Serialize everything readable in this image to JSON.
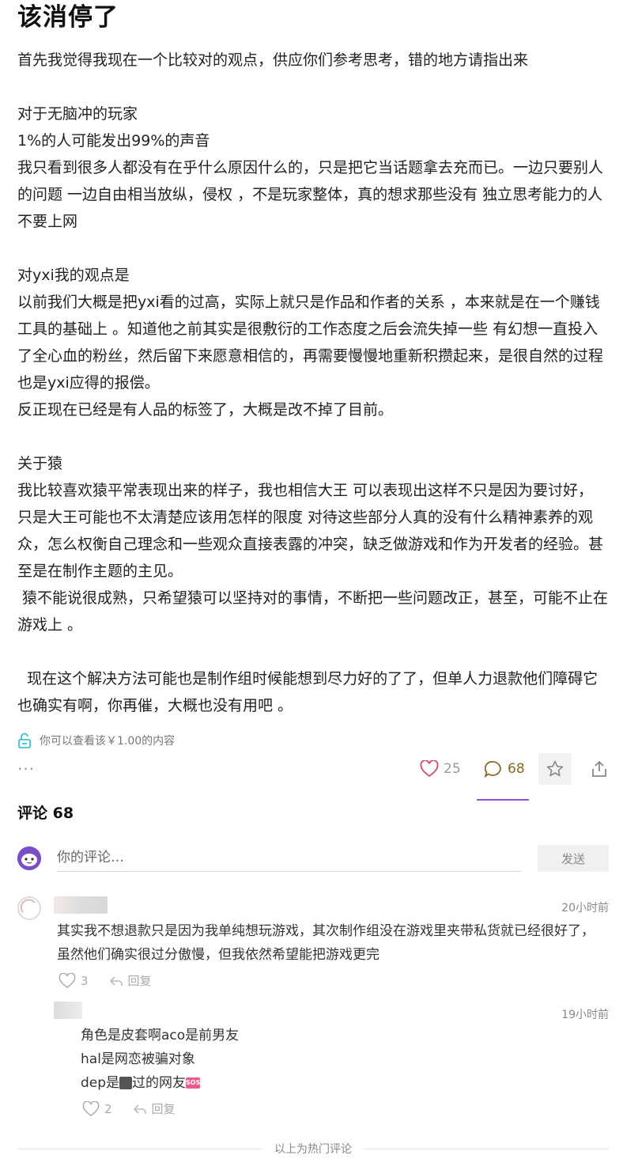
{
  "post": {
    "title": "该消停了",
    "paragraphs": [
      "首先我觉得我现在一个比较对的观点，供应你们参考思考，错的地方请指出来",
      "",
      "对于无脑冲的玩家",
      "1%的人可能发出99%的声音",
      "我只看到很多人都没有在乎什么原因什么的，只是把它当话题拿去充而已。一边只要别人的问题 一边自由相当放纵，侵权 ，不是玩家整体，真的想求那些没有 独立思考能力的人不要上网",
      "",
      "对yxi我的观点是",
      "以前我们大概是把yxi看的过高，实际上就只是作品和作者的关系 ，本来就是在一个赚钱工具的基础上 。知道他之前其实是很敷衍的工作态度之后会流失掉一些 有幻想一直投入了全心血的粉丝，然后留下来愿意相信的，再需要慢慢地重新积攒起来，是很自然的过程 也是yxi应得的报偿。",
      "反正现在已经是有人品的标签了，大概是改不掉了目前。",
      "",
      "关于猿",
      "我比较喜欢猿平常表现出来的样子，我也相信大王 可以表现出这样不只是因为要讨好， 只是大王可能也不太清楚应该用怎样的限度 对待这些部分人真的没有什么精神素养的观众，怎么权衡自己理念和一些观众直接表露的冲突，缺乏做游戏和作为开发者的经验。甚至是在制作主题的主见。",
      " 猿不能说很成熟，只希望猿可以坚持对的事情，不断把一些问题改正，甚至，可能不止在游戏上 。",
      "",
      "  现在这个解决方法可能也是制作组时候能想到尽力好的了了，但单人力退款他们障碍它也确实有啊，你再催，大概也没有用吧 。"
    ],
    "unlock_text": "你可以查看该￥1.00的内容",
    "more": "···",
    "like_count": "25",
    "comment_count": "68"
  },
  "comments": {
    "header": "评论 68",
    "input_placeholder": "你的评论…",
    "send_label": "发送",
    "items": [
      {
        "time": "20小时前",
        "text": "其实我不想退款只是因为我单纯想玩游戏，其次制作组没在游戏里夹带私货就已经很好了，虽然他们确实很过分傲慢，但我依然希望能把游戏更完",
        "likes": "3",
        "reply_label": "回复"
      },
      {
        "time": "19小时前",
        "lines": [
          "角色是皮套啊aco是前男友",
          "hal是网恋被骗对象",
          "dep是",
          "过的网友"
        ],
        "badge": "SOS",
        "likes": "2",
        "reply_label": "回复"
      }
    ],
    "footer": "以上为热门评论"
  },
  "colors": {
    "accent_purple": "#8a55d8",
    "like_icon": "#d04a6a",
    "comment_icon": "#8a6a2a",
    "unlock_icon": "#29b8c8"
  }
}
